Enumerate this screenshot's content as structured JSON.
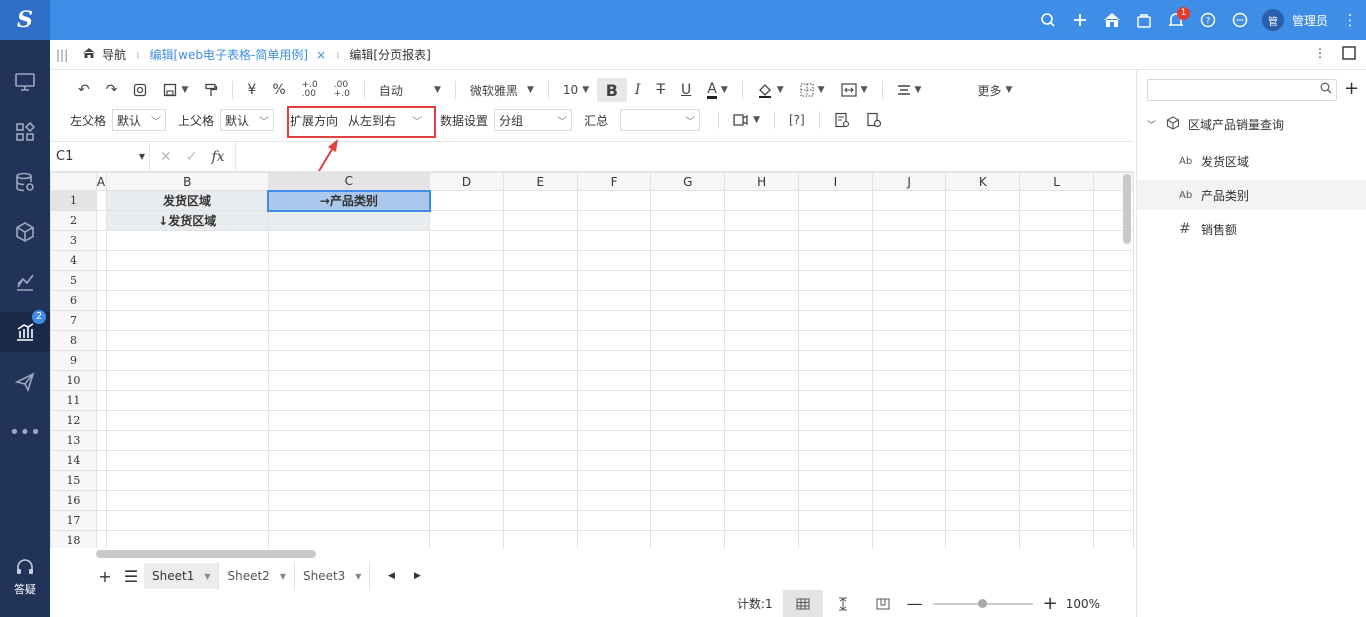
{
  "topbar": {
    "logo": "S",
    "badge_count": "1",
    "avatar_text": "管",
    "user_name": "管理员"
  },
  "sidebar": {
    "report_badge": "2",
    "help_label": "答疑"
  },
  "tabs": {
    "nav": "导航",
    "active_tab": "编辑[web电子表格-简单用例]",
    "close": "×",
    "second_tab": "编辑[分页报表]"
  },
  "toolbar": {
    "currency": "¥",
    "percent": "%",
    "auto": "自动",
    "font": "微软雅黑",
    "font_size": "10",
    "bold": "B",
    "italic": "I",
    "strike": "T",
    "underline": "U",
    "font_color": "A",
    "more": "更多",
    "left_parent_label": "左父格",
    "left_parent_value": "默认",
    "top_parent_label": "上父格",
    "top_parent_value": "默认",
    "expand_label": "扩展方向",
    "expand_value": "从左到右",
    "data_setting_label": "数据设置",
    "data_setting_value": "分组",
    "summary_label": "汇总",
    "param_btn": "[?]"
  },
  "formula": {
    "cell_ref": "C1",
    "fx": "fx"
  },
  "sheet": {
    "columns": [
      "A",
      "B",
      "C",
      "D",
      "E",
      "F",
      "G",
      "H",
      "I",
      "J",
      "K",
      "L"
    ],
    "rows": [
      "1",
      "2",
      "3",
      "4",
      "5",
      "6",
      "7",
      "8",
      "9",
      "10",
      "11",
      "12",
      "13",
      "14",
      "15",
      "16",
      "17",
      "18"
    ],
    "cells": {
      "B1": "发货区域",
      "C1": "→产品类别",
      "B2": "↓发货区域"
    }
  },
  "sheet_tabs": [
    "Sheet1",
    "Sheet2",
    "Sheet3"
  ],
  "status": {
    "count": "计数:1",
    "zoom": "100%"
  },
  "right_panel": {
    "dataset": "区域产品销量查询",
    "fields": [
      {
        "icon": "Ab",
        "name": "发货区域"
      },
      {
        "icon": "Ab",
        "name": "产品类别"
      },
      {
        "icon": "#",
        "name": "销售额"
      }
    ]
  }
}
